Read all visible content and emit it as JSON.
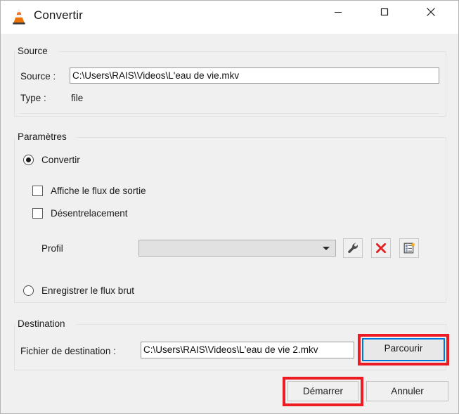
{
  "window": {
    "title": "Convertir",
    "icon": "vlc-cone-icon",
    "controls": {
      "minimize": "minimize-icon",
      "maximize": "maximize-icon",
      "close": "close-icon"
    }
  },
  "source": {
    "group_title": "Source",
    "source_label": "Source :",
    "source_value": "C:\\Users\\RAIS\\Videos\\L'eau de vie.mkv",
    "type_label": "Type :",
    "type_value": "file"
  },
  "parameters": {
    "group_title": "Paramètres",
    "convert_radio_label": "Convertir",
    "convert_radio_selected": true,
    "display_output_label": "Affiche le flux de sortie",
    "display_output_checked": false,
    "deinterlace_label": "Désentrelacement",
    "deinterlace_checked": false,
    "profile_label": "Profil",
    "profile_value": "",
    "profile_edit_icon": "wrench-icon",
    "profile_delete_icon": "red-x-icon",
    "profile_new_icon": "new-profile-icon",
    "raw_radio_label": "Enregistrer le flux brut",
    "raw_radio_selected": false
  },
  "destination": {
    "group_title": "Destination",
    "file_label": "Fichier de destination :",
    "file_value": "C:\\Users\\RAIS\\Videos\\L'eau de vie 2.mkv",
    "browse_button": "Parcourir"
  },
  "footer": {
    "start_button": "Démarrer",
    "cancel_button": "Annuler"
  },
  "colors": {
    "annotation": "#ed1c24",
    "focus": "#0078d7",
    "accent_orange": "#ec7a08",
    "delete_red": "#e02020"
  }
}
